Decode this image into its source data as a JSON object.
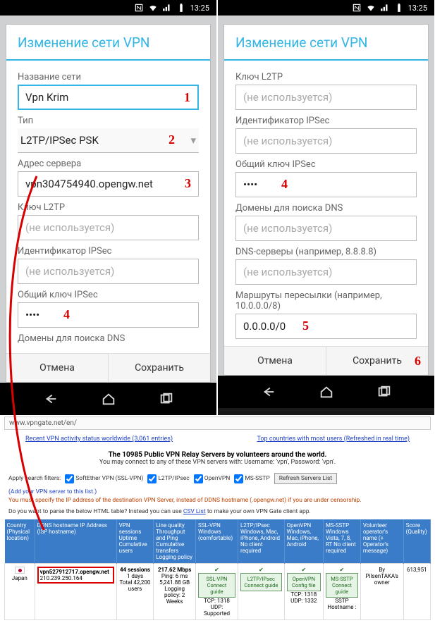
{
  "statusbar": {
    "time": "13:25"
  },
  "dialog": {
    "title": "Изменение сети VPN",
    "buttons": {
      "cancel": "Отмена",
      "save": "Сохранить"
    }
  },
  "phone1": {
    "name_label": "Название сети",
    "name_value": "Vpn Krim",
    "type_label": "Тип",
    "type_value": "L2TP/IPSec PSK",
    "server_label": "Адрес сервера",
    "server_value": "vpn304754940.opengw.net",
    "l2tp_label": "Ключ L2TP",
    "l2tp_placeholder": "(не используется)",
    "ipsec_id_label": "Идентификатор IPSec",
    "ipsec_id_placeholder": "(не используется)",
    "ipsec_key_label": "Общий ключ IPSec",
    "ipsec_key_value": "••••",
    "dns_search_label": "Домены для поиска DNS"
  },
  "phone2": {
    "l2tp_label": "Ключ L2TP",
    "l2tp_placeholder": "(не используется)",
    "ipsec_id_label": "Идентификатор IPSec",
    "ipsec_id_placeholder": "(не используется)",
    "ipsec_key_label": "Общий ключ IPSec",
    "ipsec_key_value": "••••",
    "dns_search_label": "Домены для поиска DNS",
    "dns_search_placeholder": "(не используется)",
    "dns_servers_label": "DNS-серверы (например, 8.8.8.8)",
    "dns_servers_placeholder": "(не используется)",
    "routes_label": "Маршруты пересылки (например, 10.0.0.0/8)",
    "routes_value": "0.0.0.0/0"
  },
  "annotations": {
    "a1": "1",
    "a2": "2",
    "a3": "3",
    "a4": "4",
    "a5": "5",
    "a6": "6"
  },
  "web": {
    "url": "www.vpngate.net/en/",
    "link_recent": "Recent VPN activity status worldwide (3,061 entries)",
    "link_top": "Top countries with most users (Refreshed in real time)",
    "heading": "The 10985 Public VPN Relay Servers by volunteers around the world.",
    "sub": "You may connect to any of these VPN servers with: Username: 'vpn', Password: 'vpn'.",
    "filters_label": "Apply search filters:",
    "f1": "SoftEther VPN (SSL-VPN)",
    "f2": "L2TP/IPsec",
    "f3": "OpenVPN",
    "f4": "MS-SSTP",
    "refresh": "Refresh Servers List",
    "add_note": "(Add your VPN server to this list.)",
    "must_note": "You must specify the IP address of the destination VPN Server, instead of DDNS hostname (.opengw.net) if you are under censorship.",
    "csv_note_a": "Do you want to parse the below HTML table? Instead you can use ",
    "csv_note_b": "CSV List",
    "csv_note_c": " to make your own VPN Gate client app.",
    "thead": {
      "c1": "Country\n(Physical location)",
      "c2": "DDNS hostname\nIP Address\n(ISP hostname)",
      "c3": "VPN sessions\nUptime\nCumulative users",
      "c4": "Line quality\nThroughput and Ping\nCumulative transfers\nLogging policy",
      "c5": "SSL-VPN\nWindows\n(comfortable)",
      "c6": "L2TP/IPsec\nWindows, Mac,\niPhone, Android\nNo client required",
      "c7": "OpenVPN\nWindows, Mac,\niPhone, Android",
      "c8": "MS-SSTP\nWindows Vista,\n7, 8, RT\nNo client required",
      "c9": "Volunteer operator's name\n(+ Operator's message)",
      "c10": "Score\n(Quality)"
    },
    "row": {
      "country": "Japan",
      "host": "vpn527912717.opengw.net",
      "ip": "210.239.250.164",
      "sessions": "44 sessions",
      "uptime": "1 days",
      "total_users": "Total 42,200 users",
      "speed": "217.62 Mbps",
      "ping": "Ping: 6 ms",
      "transfer": "5,241.88 GB",
      "logging": "Logging policy:\n2 Weeks",
      "sslvpn": "SSL-VPN\nConnect guide",
      "sslvpn_ports": "TCP: 1318\nUDP: Supported",
      "l2tp": "L2TP/IPsec\nConnect guide",
      "openvpn": "OpenVPN\nConfig file",
      "openvpn_ports": "TCP: 1318\nUDP: 1332",
      "sstp": "MS-SSTP\nConnect guide",
      "sstp_host": "SSTP Hostname :",
      "operator": "By PilsenTAKA's owner",
      "score": "613,951"
    }
  }
}
